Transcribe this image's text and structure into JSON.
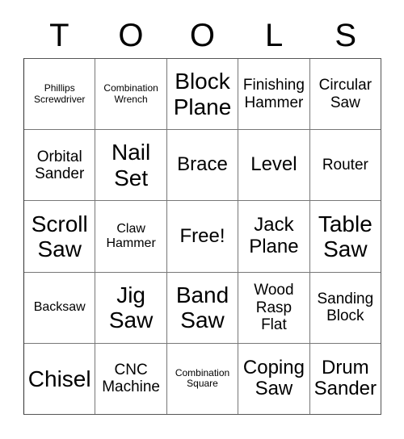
{
  "card": {
    "title_letters": [
      "T",
      "O",
      "O",
      "L",
      "S"
    ],
    "columns": 5,
    "rows": 5,
    "text_color": "#000000",
    "background_color": "#ffffff",
    "border_color": "#777777",
    "outer_border_color": "#555555",
    "free_space": {
      "row": 3,
      "column": 3,
      "label": "Free!"
    }
  },
  "grid": {
    "rows": [
      {
        "cells": [
          {
            "label": "Phillips\nScrewdriver",
            "size": "xs"
          },
          {
            "label": "Combination\nWrench",
            "size": "xs"
          },
          {
            "label": "Block\nPlane",
            "size": "xl"
          },
          {
            "label": "Finishing\nHammer",
            "size": "md"
          },
          {
            "label": "Circular\nSaw",
            "size": "md"
          }
        ]
      },
      {
        "cells": [
          {
            "label": "Orbital\nSander",
            "size": "md"
          },
          {
            "label": "Nail\nSet",
            "size": "xl"
          },
          {
            "label": "Brace",
            "size": "lg"
          },
          {
            "label": "Level",
            "size": "lg"
          },
          {
            "label": "Router",
            "size": "md"
          }
        ]
      },
      {
        "cells": [
          {
            "label": "Scroll\nSaw",
            "size": "xl"
          },
          {
            "label": "Claw\nHammer",
            "size": "sm"
          },
          {
            "label": "Free!",
            "size": "lg"
          },
          {
            "label": "Jack\nPlane",
            "size": "lg"
          },
          {
            "label": "Table\nSaw",
            "size": "xl"
          }
        ]
      },
      {
        "cells": [
          {
            "label": "Backsaw",
            "size": "sm"
          },
          {
            "label": "Jig\nSaw",
            "size": "xl"
          },
          {
            "label": "Band\nSaw",
            "size": "xl"
          },
          {
            "label": "Wood\nRasp\nFlat",
            "size": "md"
          },
          {
            "label": "Sanding\nBlock",
            "size": "md"
          }
        ]
      },
      {
        "cells": [
          {
            "label": "Chisel",
            "size": "xl"
          },
          {
            "label": "CNC\nMachine",
            "size": "md"
          },
          {
            "label": "Combination\nSquare",
            "size": "xs"
          },
          {
            "label": "Coping\nSaw",
            "size": "lg"
          },
          {
            "label": "Drum\nSander",
            "size": "lg"
          }
        ]
      }
    ]
  }
}
